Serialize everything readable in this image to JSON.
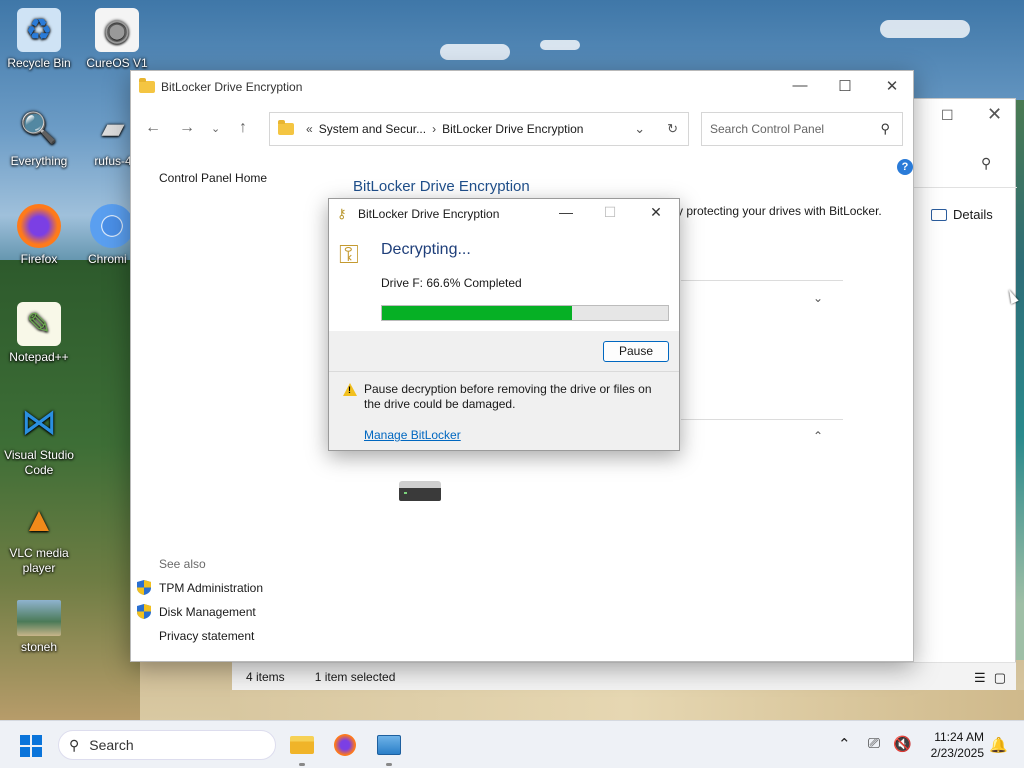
{
  "desktop_icons": [
    {
      "label": "Recycle Bin",
      "icon": "recycle-bin-icon"
    },
    {
      "label": "CureOS V1",
      "icon": "disc-file-icon"
    },
    {
      "label": "Everything",
      "icon": "search-magnifier-icon"
    },
    {
      "label": "rufus-4",
      "icon": "usb-drive-icon"
    },
    {
      "label": "Firefox",
      "icon": "firefox-icon"
    },
    {
      "label": "Chromi",
      "icon": "chromium-icon"
    },
    {
      "label": "Notepad++",
      "icon": "notepad-plus-plus-icon"
    },
    {
      "label": "Visual Studio Code",
      "icon": "vscode-icon"
    },
    {
      "label": "VLC media player",
      "icon": "vlc-icon"
    },
    {
      "label": "stoneh",
      "icon": "image-file-icon"
    }
  ],
  "control_panel": {
    "title": "BitLocker Drive Encryption",
    "breadcrumb_prefix": "«",
    "breadcrumb": [
      "System and Secur...",
      "BitLocker Drive Encryption"
    ],
    "search_placeholder": "Search Control Panel",
    "home_link": "Control Panel Home",
    "heading": "BitLocker Drive Encryption",
    "description": "y protecting your drives with BitLocker.",
    "see_also_label": "See also",
    "see_also": [
      "TPM Administration",
      "Disk Management",
      "Privacy statement"
    ]
  },
  "back_window": {
    "details_label": "Details",
    "status_items": "4 items",
    "status_selected": "1 item selected"
  },
  "dialog": {
    "title": "BitLocker Drive Encryption",
    "heading": "Decrypting...",
    "status": "Drive F: 66.6% Completed",
    "progress_percent": 66.6,
    "pause_label": "Pause",
    "warning": "Pause decryption before removing the drive or files on the drive could be damaged.",
    "manage_link": "Manage BitLocker"
  },
  "taskbar": {
    "search_label": "Search",
    "time": "11:24 AM",
    "date": "2/23/2025",
    "pinned": [
      "file-explorer-icon",
      "firefox-icon",
      "control-panel-icon"
    ]
  },
  "colors": {
    "accent": "#0067c0",
    "progress_fill": "#06b025",
    "heading_blue": "#1f4f8b"
  }
}
